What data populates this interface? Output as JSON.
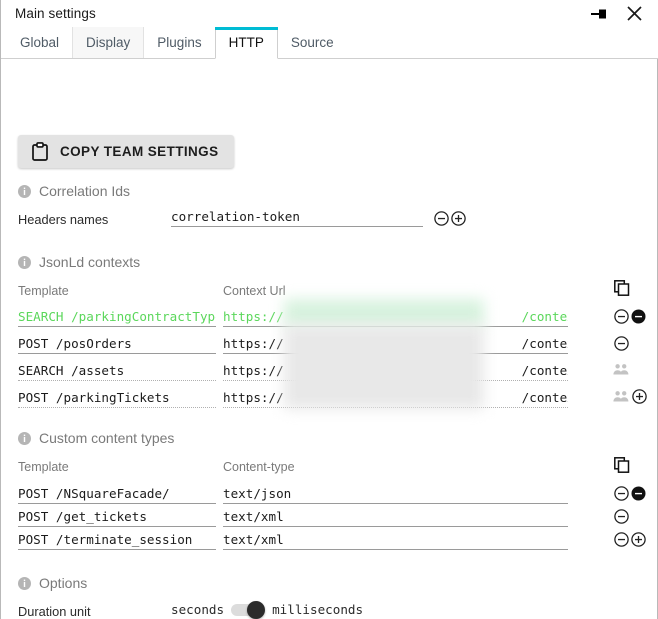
{
  "window": {
    "title": "Main settings",
    "pin_icon": "pin-icon",
    "close_icon": "close-icon"
  },
  "tabs": [
    {
      "label": "Global",
      "state": "normal"
    },
    {
      "label": "Display",
      "state": "hover"
    },
    {
      "label": "Plugins",
      "state": "normal"
    },
    {
      "label": "HTTP",
      "state": "active"
    },
    {
      "label": "Source",
      "state": "normal"
    }
  ],
  "toolbar": {
    "copy_team_settings_label": "COPY TEAM SETTINGS",
    "clipboard_icon": "clipboard-icon"
  },
  "sections": {
    "correlation_ids": {
      "title": "Correlation Ids",
      "info_icon": "info-icon",
      "field_label": "Headers names",
      "value": "correlation-token",
      "remove_icon": "minus-circle-icon",
      "add_icon": "plus-circle-icon"
    },
    "jsonld_contexts": {
      "title": "JsonLd contexts",
      "info_icon": "info-icon",
      "columns": {
        "template": "Template",
        "context_url": "Context Url"
      },
      "copy_icon": "copy-icon",
      "rows": [
        {
          "template": "SEARCH /parkingContractType",
          "url_prefix": "https://",
          "url_suffix": "/contexts/\\",
          "highlighted": true,
          "underline": "solid",
          "actions": [
            "minus-circle-icon",
            "minus-circle-filled-icon"
          ]
        },
        {
          "template": "POST /posOrders",
          "url_prefix": "https://",
          "url_suffix": "/contexts/\\",
          "highlighted": false,
          "underline": "solid",
          "actions": [
            "minus-circle-icon"
          ]
        },
        {
          "template": "SEARCH /assets",
          "url_prefix": "https://",
          "url_suffix": "/contexts/\\",
          "highlighted": false,
          "underline": "dotted",
          "actions": [
            "people-icon"
          ]
        },
        {
          "template": "POST /parkingTickets",
          "url_prefix": "https://",
          "url_suffix": "/contexts/\\",
          "highlighted": false,
          "underline": "dotted",
          "actions": [
            "people-icon",
            "plus-circle-icon"
          ]
        }
      ]
    },
    "custom_content_types": {
      "title": "Custom content types",
      "info_icon": "info-icon",
      "columns": {
        "template": "Template",
        "content_type": "Content-type"
      },
      "copy_icon": "copy-icon",
      "rows": [
        {
          "template": "POST /NSquareFacade/",
          "content_type": "text/json",
          "actions": [
            "minus-circle-icon",
            "minus-circle-filled-icon"
          ]
        },
        {
          "template": "POST /get_tickets",
          "content_type": "text/xml",
          "actions": [
            "minus-circle-icon"
          ]
        },
        {
          "template": "POST /terminate_session",
          "content_type": "text/xml",
          "actions": [
            "minus-circle-icon",
            "plus-circle-icon"
          ]
        }
      ]
    },
    "options": {
      "title": "Options",
      "info_icon": "info-icon",
      "duration_unit": {
        "label": "Duration unit",
        "option_left": "seconds",
        "option_right": "milliseconds",
        "selected": "milliseconds"
      }
    }
  },
  "colors": {
    "accent": "#00bcd4",
    "highlight_green": "#5bd75b",
    "section_header": "#7a7a7a",
    "button_bg": "#e3e3e3"
  }
}
